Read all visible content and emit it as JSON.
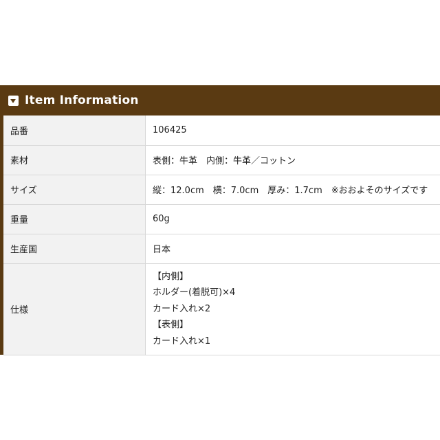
{
  "section": {
    "title": "Item Information"
  },
  "rows": [
    {
      "label": "品番",
      "value": "106425"
    },
    {
      "label": "素材",
      "value": "表側：牛革　内側：牛革／コットン"
    },
    {
      "label": "サイズ",
      "value": "縦：12.0cm　横：7.0cm　厚み：1.7cm　※おおよそのサイズです"
    },
    {
      "label": "重量",
      "value": "60g"
    },
    {
      "label": "生産国",
      "value": "日本"
    },
    {
      "label": "仕様",
      "lines": [
        "【内側】",
        "ホルダー(着脱可)×4",
        "カード入れ×2",
        "【表側】",
        "カード入れ×1"
      ]
    }
  ]
}
